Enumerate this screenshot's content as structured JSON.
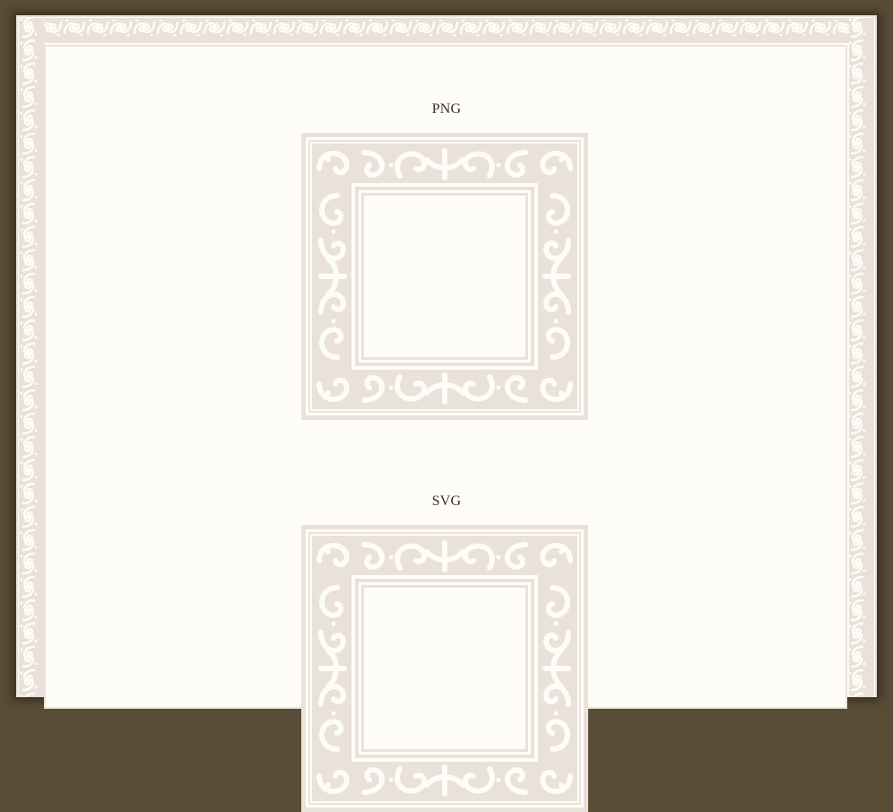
{
  "page": {
    "background_color": "#5a4d37",
    "paper_color": "#fefcf6",
    "ornament_color": "#e9e1da"
  },
  "sections": [
    {
      "label": "PNG",
      "ornament": "square-ornamental-frame"
    },
    {
      "label": "SVG",
      "ornament": "square-ornamental-frame"
    }
  ]
}
